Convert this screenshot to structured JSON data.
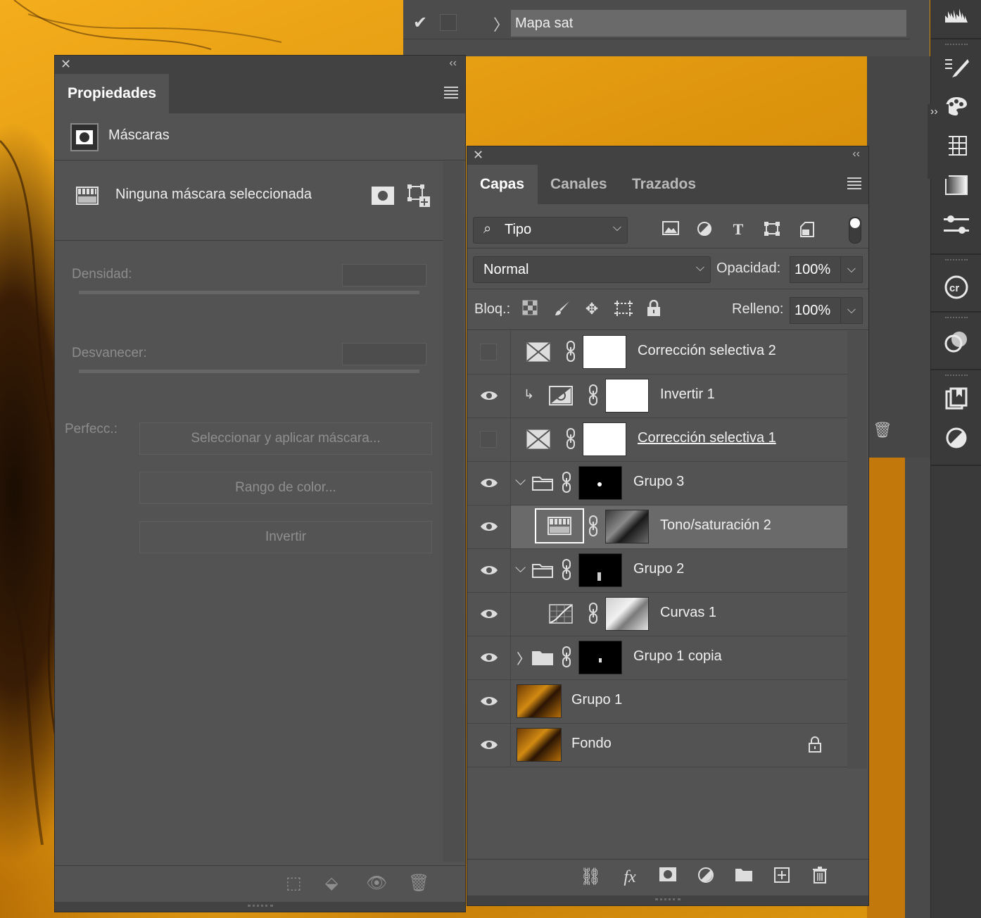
{
  "top_strip": {
    "layer_name": "Mapa sat"
  },
  "properties": {
    "tab_label": "Propiedades",
    "section_title": "Máscaras",
    "no_mask_label": "Ninguna máscara seleccionada",
    "density_label": "Densidad:",
    "feather_label": "Desvanecer:",
    "refine_label": "Perfecc.:",
    "buttons": {
      "select_mask": "Seleccionar y aplicar máscara...",
      "color_range": "Rango de color...",
      "invert": "Invertir"
    }
  },
  "layers_panel": {
    "tabs": [
      {
        "label": "Capas",
        "active": true
      },
      {
        "label": "Canales",
        "active": false
      },
      {
        "label": "Trazados",
        "active": false
      }
    ],
    "filter_label": "Tipo",
    "blend_mode": "Normal",
    "opacity_label": "Opacidad:",
    "opacity_value": "100%",
    "lock_label": "Bloq.:",
    "fill_label": "Relleno:",
    "fill_value": "100%",
    "layers": [
      {
        "name": "Corrección selectiva 2",
        "visible": false,
        "kind": "selective-color",
        "mask": "white",
        "underline": false
      },
      {
        "name": "Invertir 1",
        "visible": true,
        "kind": "invert",
        "mask": "white",
        "clipped": true
      },
      {
        "name": "Corrección selectiva 1",
        "visible": false,
        "kind": "selective-color",
        "mask": "white",
        "underline": true
      },
      {
        "name": "Grupo 3",
        "visible": true,
        "kind": "group",
        "expanded": true,
        "mask": "black"
      },
      {
        "name": "Tono/saturación 2",
        "visible": true,
        "kind": "hue-saturation",
        "mask": "photo-bw",
        "selected": true
      },
      {
        "name": "Grupo 2",
        "visible": true,
        "kind": "group",
        "expanded": true,
        "mask": "black"
      },
      {
        "name": "Curvas 1",
        "visible": true,
        "kind": "curves",
        "mask": "photo-bw-light"
      },
      {
        "name": "Grupo 1 copia",
        "visible": true,
        "kind": "group",
        "expanded": false,
        "mask": "black"
      },
      {
        "name": "Grupo 1",
        "visible": true,
        "kind": "pixel",
        "thumb": "photo"
      },
      {
        "name": "Fondo",
        "visible": true,
        "kind": "background",
        "thumb": "photo",
        "locked": true
      }
    ]
  }
}
